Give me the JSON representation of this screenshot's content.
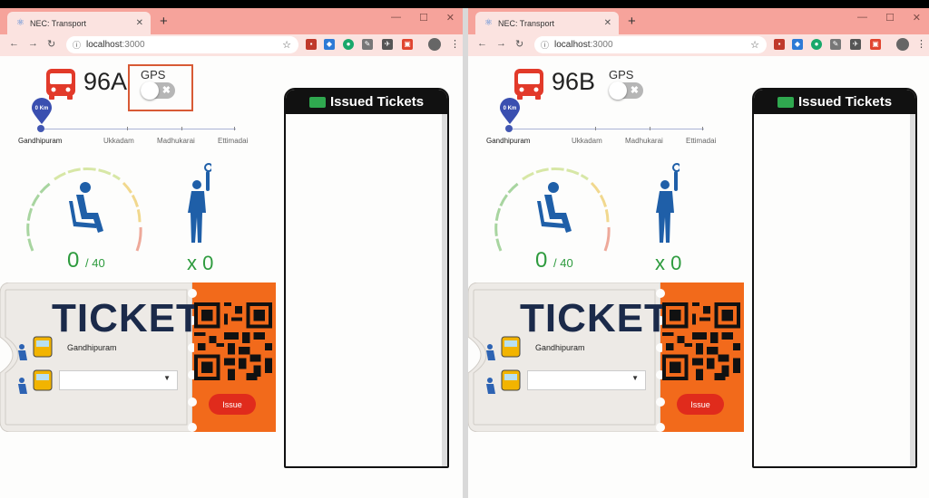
{
  "browser": {
    "tab_title": "NEC: Transport",
    "url_host": "localhost",
    "url_port": ":3000"
  },
  "windows": [
    {
      "route": "96A",
      "gps_label": "GPS",
      "gps_on": false,
      "marker_label": "0 Km",
      "stops": [
        "Gandhipuram",
        "Ukkadam",
        "Madhukarai",
        "Ettimadai"
      ],
      "seated": "0",
      "capacity": "/ 40",
      "standing": "x 0",
      "ticket_title": "TICKET",
      "origin": "Gandhipuram",
      "destination": "",
      "issue_label": "Issue",
      "panel_title": "Issued Tickets"
    },
    {
      "route": "96B",
      "gps_label": "GPS",
      "gps_on": false,
      "marker_label": "0 Km",
      "stops": [
        "Gandhipuram",
        "Ukkadam",
        "Madhukarai",
        "Ettimadai"
      ],
      "seated": "0",
      "capacity": "/ 40",
      "standing": "x 0",
      "ticket_title": "TICKET",
      "origin": "Gandhipuram",
      "destination": "",
      "issue_label": "Issue",
      "panel_title": "Issued Tickets"
    }
  ],
  "colors": {
    "titlebar": "#f6a39b",
    "accent_green": "#2e9b3e",
    "issue_red": "#e02b1c",
    "ticket_navy": "#1b2a4a",
    "qr_orange": "#f26a1b"
  }
}
